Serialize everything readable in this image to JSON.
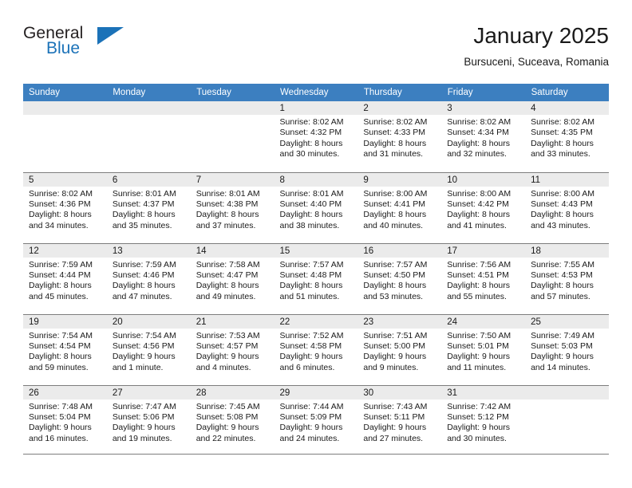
{
  "brand": {
    "name_top": "General",
    "name_bottom": "Blue",
    "triangle_icon": "blue-triangle-logo-mark",
    "color_dark": "#231f20",
    "color_blue": "#1b72b8"
  },
  "header": {
    "title": "January 2025",
    "location": "Bursuceni, Suceava, Romania"
  },
  "theme": {
    "header_bg": "#3c7fc0",
    "daynum_bg": "#ebebeb",
    "grid_line": "#7d7d7d",
    "text": "#1a1a1a"
  },
  "weekdays": [
    "Sunday",
    "Monday",
    "Tuesday",
    "Wednesday",
    "Thursday",
    "Friday",
    "Saturday"
  ],
  "labels": {
    "sunrise_prefix": "Sunrise:",
    "sunset_prefix": "Sunset:",
    "daylight_prefix": "Daylight:"
  },
  "weeks": [
    [
      {
        "day": "",
        "sunrise": "",
        "sunset": "",
        "daylight_line1": "",
        "daylight_line2": ""
      },
      {
        "day": "",
        "sunrise": "",
        "sunset": "",
        "daylight_line1": "",
        "daylight_line2": ""
      },
      {
        "day": "",
        "sunrise": "",
        "sunset": "",
        "daylight_line1": "",
        "daylight_line2": ""
      },
      {
        "day": "1",
        "sunrise": "Sunrise: 8:02 AM",
        "sunset": "Sunset: 4:32 PM",
        "daylight_line1": "Daylight: 8 hours",
        "daylight_line2": "and 30 minutes."
      },
      {
        "day": "2",
        "sunrise": "Sunrise: 8:02 AM",
        "sunset": "Sunset: 4:33 PM",
        "daylight_line1": "Daylight: 8 hours",
        "daylight_line2": "and 31 minutes."
      },
      {
        "day": "3",
        "sunrise": "Sunrise: 8:02 AM",
        "sunset": "Sunset: 4:34 PM",
        "daylight_line1": "Daylight: 8 hours",
        "daylight_line2": "and 32 minutes."
      },
      {
        "day": "4",
        "sunrise": "Sunrise: 8:02 AM",
        "sunset": "Sunset: 4:35 PM",
        "daylight_line1": "Daylight: 8 hours",
        "daylight_line2": "and 33 minutes."
      }
    ],
    [
      {
        "day": "5",
        "sunrise": "Sunrise: 8:02 AM",
        "sunset": "Sunset: 4:36 PM",
        "daylight_line1": "Daylight: 8 hours",
        "daylight_line2": "and 34 minutes."
      },
      {
        "day": "6",
        "sunrise": "Sunrise: 8:01 AM",
        "sunset": "Sunset: 4:37 PM",
        "daylight_line1": "Daylight: 8 hours",
        "daylight_line2": "and 35 minutes."
      },
      {
        "day": "7",
        "sunrise": "Sunrise: 8:01 AM",
        "sunset": "Sunset: 4:38 PM",
        "daylight_line1": "Daylight: 8 hours",
        "daylight_line2": "and 37 minutes."
      },
      {
        "day": "8",
        "sunrise": "Sunrise: 8:01 AM",
        "sunset": "Sunset: 4:40 PM",
        "daylight_line1": "Daylight: 8 hours",
        "daylight_line2": "and 38 minutes."
      },
      {
        "day": "9",
        "sunrise": "Sunrise: 8:00 AM",
        "sunset": "Sunset: 4:41 PM",
        "daylight_line1": "Daylight: 8 hours",
        "daylight_line2": "and 40 minutes."
      },
      {
        "day": "10",
        "sunrise": "Sunrise: 8:00 AM",
        "sunset": "Sunset: 4:42 PM",
        "daylight_line1": "Daylight: 8 hours",
        "daylight_line2": "and 41 minutes."
      },
      {
        "day": "11",
        "sunrise": "Sunrise: 8:00 AM",
        "sunset": "Sunset: 4:43 PM",
        "daylight_line1": "Daylight: 8 hours",
        "daylight_line2": "and 43 minutes."
      }
    ],
    [
      {
        "day": "12",
        "sunrise": "Sunrise: 7:59 AM",
        "sunset": "Sunset: 4:44 PM",
        "daylight_line1": "Daylight: 8 hours",
        "daylight_line2": "and 45 minutes."
      },
      {
        "day": "13",
        "sunrise": "Sunrise: 7:59 AM",
        "sunset": "Sunset: 4:46 PM",
        "daylight_line1": "Daylight: 8 hours",
        "daylight_line2": "and 47 minutes."
      },
      {
        "day": "14",
        "sunrise": "Sunrise: 7:58 AM",
        "sunset": "Sunset: 4:47 PM",
        "daylight_line1": "Daylight: 8 hours",
        "daylight_line2": "and 49 minutes."
      },
      {
        "day": "15",
        "sunrise": "Sunrise: 7:57 AM",
        "sunset": "Sunset: 4:48 PM",
        "daylight_line1": "Daylight: 8 hours",
        "daylight_line2": "and 51 minutes."
      },
      {
        "day": "16",
        "sunrise": "Sunrise: 7:57 AM",
        "sunset": "Sunset: 4:50 PM",
        "daylight_line1": "Daylight: 8 hours",
        "daylight_line2": "and 53 minutes."
      },
      {
        "day": "17",
        "sunrise": "Sunrise: 7:56 AM",
        "sunset": "Sunset: 4:51 PM",
        "daylight_line1": "Daylight: 8 hours",
        "daylight_line2": "and 55 minutes."
      },
      {
        "day": "18",
        "sunrise": "Sunrise: 7:55 AM",
        "sunset": "Sunset: 4:53 PM",
        "daylight_line1": "Daylight: 8 hours",
        "daylight_line2": "and 57 minutes."
      }
    ],
    [
      {
        "day": "19",
        "sunrise": "Sunrise: 7:54 AM",
        "sunset": "Sunset: 4:54 PM",
        "daylight_line1": "Daylight: 8 hours",
        "daylight_line2": "and 59 minutes."
      },
      {
        "day": "20",
        "sunrise": "Sunrise: 7:54 AM",
        "sunset": "Sunset: 4:56 PM",
        "daylight_line1": "Daylight: 9 hours",
        "daylight_line2": "and 1 minute."
      },
      {
        "day": "21",
        "sunrise": "Sunrise: 7:53 AM",
        "sunset": "Sunset: 4:57 PM",
        "daylight_line1": "Daylight: 9 hours",
        "daylight_line2": "and 4 minutes."
      },
      {
        "day": "22",
        "sunrise": "Sunrise: 7:52 AM",
        "sunset": "Sunset: 4:58 PM",
        "daylight_line1": "Daylight: 9 hours",
        "daylight_line2": "and 6 minutes."
      },
      {
        "day": "23",
        "sunrise": "Sunrise: 7:51 AM",
        "sunset": "Sunset: 5:00 PM",
        "daylight_line1": "Daylight: 9 hours",
        "daylight_line2": "and 9 minutes."
      },
      {
        "day": "24",
        "sunrise": "Sunrise: 7:50 AM",
        "sunset": "Sunset: 5:01 PM",
        "daylight_line1": "Daylight: 9 hours",
        "daylight_line2": "and 11 minutes."
      },
      {
        "day": "25",
        "sunrise": "Sunrise: 7:49 AM",
        "sunset": "Sunset: 5:03 PM",
        "daylight_line1": "Daylight: 9 hours",
        "daylight_line2": "and 14 minutes."
      }
    ],
    [
      {
        "day": "26",
        "sunrise": "Sunrise: 7:48 AM",
        "sunset": "Sunset: 5:04 PM",
        "daylight_line1": "Daylight: 9 hours",
        "daylight_line2": "and 16 minutes."
      },
      {
        "day": "27",
        "sunrise": "Sunrise: 7:47 AM",
        "sunset": "Sunset: 5:06 PM",
        "daylight_line1": "Daylight: 9 hours",
        "daylight_line2": "and 19 minutes."
      },
      {
        "day": "28",
        "sunrise": "Sunrise: 7:45 AM",
        "sunset": "Sunset: 5:08 PM",
        "daylight_line1": "Daylight: 9 hours",
        "daylight_line2": "and 22 minutes."
      },
      {
        "day": "29",
        "sunrise": "Sunrise: 7:44 AM",
        "sunset": "Sunset: 5:09 PM",
        "daylight_line1": "Daylight: 9 hours",
        "daylight_line2": "and 24 minutes."
      },
      {
        "day": "30",
        "sunrise": "Sunrise: 7:43 AM",
        "sunset": "Sunset: 5:11 PM",
        "daylight_line1": "Daylight: 9 hours",
        "daylight_line2": "and 27 minutes."
      },
      {
        "day": "31",
        "sunrise": "Sunrise: 7:42 AM",
        "sunset": "Sunset: 5:12 PM",
        "daylight_line1": "Daylight: 9 hours",
        "daylight_line2": "and 30 minutes."
      },
      {
        "day": "",
        "sunrise": "",
        "sunset": "",
        "daylight_line1": "",
        "daylight_line2": ""
      }
    ]
  ]
}
